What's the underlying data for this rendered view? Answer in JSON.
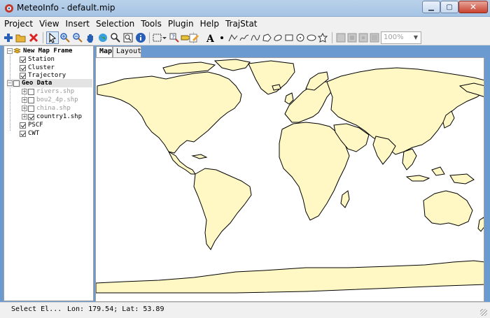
{
  "window": {
    "title": "MeteoInfo - default.mip"
  },
  "menu": [
    "Project",
    "View",
    "Insert",
    "Selection",
    "Tools",
    "Plugin",
    "Help",
    "TrajStat"
  ],
  "toolbar": {
    "zoom_value": "100%",
    "icons": [
      "add-layer-icon",
      "open-icon",
      "remove-layer-icon",
      "select-icon",
      "zoom-in-icon",
      "zoom-out-icon",
      "pan-icon",
      "full-extent-icon",
      "zoom-icon",
      "zoom-layer-icon",
      "identify-icon",
      "select-features-icon",
      "select-dropdown-icon",
      "measure-icon",
      "label-icon",
      "edit-icon",
      "text-icon",
      "point-icon",
      "polyline-icon",
      "freehand-icon",
      "curve-icon",
      "polygon-icon",
      "ellipse-icon",
      "rectangle-icon",
      "circle-icon",
      "curve-polygon-icon",
      "star-icon",
      "layout-icon-1",
      "layout-icon-2",
      "layout-icon-3",
      "layout-icon-4"
    ]
  },
  "legend": {
    "items": [
      {
        "label": "New Map Frame",
        "style": "bold"
      },
      {
        "label": "Station",
        "checked": true
      },
      {
        "label": "Cluster",
        "checked": true
      },
      {
        "label": "Trajectory",
        "checked": true
      },
      {
        "label": "Geo Data",
        "checked": false,
        "style": "bold"
      },
      {
        "label": "rivers.shp",
        "checked": false,
        "style": "grey"
      },
      {
        "label": "bou2_4p.shp",
        "checked": false,
        "style": "grey"
      },
      {
        "label": "china.shp",
        "checked": false,
        "style": "grey"
      },
      {
        "label": "country1.shp",
        "checked": true
      },
      {
        "label": "PSCF",
        "checked": true
      },
      {
        "label": "CWT",
        "checked": true
      }
    ]
  },
  "tabs": [
    "Map",
    "Layout"
  ],
  "colors": {
    "land": "#fff8c4",
    "border": "#000000"
  },
  "status": {
    "action": "Select El...",
    "coords": "Lon: 179.54; Lat: 53.89"
  }
}
